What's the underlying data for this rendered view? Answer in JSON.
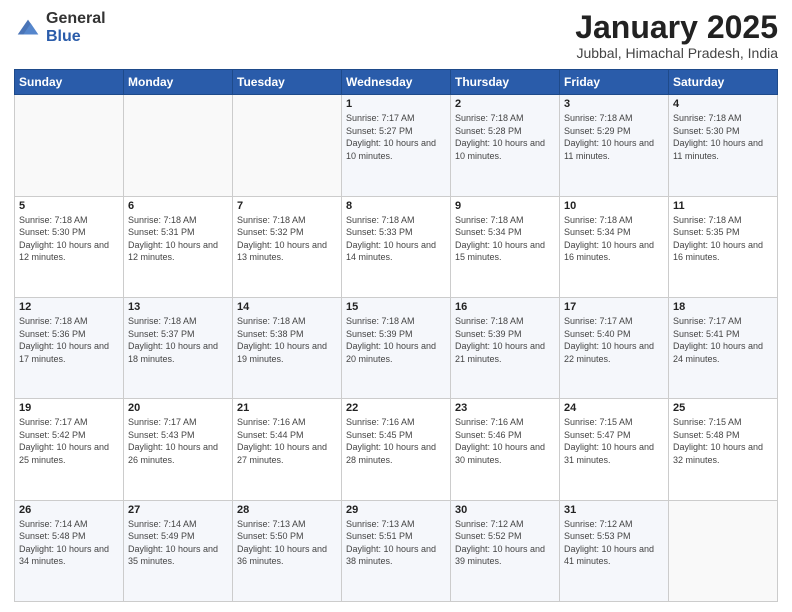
{
  "header": {
    "logo_general": "General",
    "logo_blue": "Blue",
    "month_title": "January 2025",
    "location": "Jubbal, Himachal Pradesh, India"
  },
  "days_of_week": [
    "Sunday",
    "Monday",
    "Tuesday",
    "Wednesday",
    "Thursday",
    "Friday",
    "Saturday"
  ],
  "weeks": [
    [
      {
        "day": "",
        "sunrise": "",
        "sunset": "",
        "daylight": ""
      },
      {
        "day": "",
        "sunrise": "",
        "sunset": "",
        "daylight": ""
      },
      {
        "day": "",
        "sunrise": "",
        "sunset": "",
        "daylight": ""
      },
      {
        "day": "1",
        "sunrise": "Sunrise: 7:17 AM",
        "sunset": "Sunset: 5:27 PM",
        "daylight": "Daylight: 10 hours and 10 minutes."
      },
      {
        "day": "2",
        "sunrise": "Sunrise: 7:18 AM",
        "sunset": "Sunset: 5:28 PM",
        "daylight": "Daylight: 10 hours and 10 minutes."
      },
      {
        "day": "3",
        "sunrise": "Sunrise: 7:18 AM",
        "sunset": "Sunset: 5:29 PM",
        "daylight": "Daylight: 10 hours and 11 minutes."
      },
      {
        "day": "4",
        "sunrise": "Sunrise: 7:18 AM",
        "sunset": "Sunset: 5:30 PM",
        "daylight": "Daylight: 10 hours and 11 minutes."
      }
    ],
    [
      {
        "day": "5",
        "sunrise": "Sunrise: 7:18 AM",
        "sunset": "Sunset: 5:30 PM",
        "daylight": "Daylight: 10 hours and 12 minutes."
      },
      {
        "day": "6",
        "sunrise": "Sunrise: 7:18 AM",
        "sunset": "Sunset: 5:31 PM",
        "daylight": "Daylight: 10 hours and 12 minutes."
      },
      {
        "day": "7",
        "sunrise": "Sunrise: 7:18 AM",
        "sunset": "Sunset: 5:32 PM",
        "daylight": "Daylight: 10 hours and 13 minutes."
      },
      {
        "day": "8",
        "sunrise": "Sunrise: 7:18 AM",
        "sunset": "Sunset: 5:33 PM",
        "daylight": "Daylight: 10 hours and 14 minutes."
      },
      {
        "day": "9",
        "sunrise": "Sunrise: 7:18 AM",
        "sunset": "Sunset: 5:34 PM",
        "daylight": "Daylight: 10 hours and 15 minutes."
      },
      {
        "day": "10",
        "sunrise": "Sunrise: 7:18 AM",
        "sunset": "Sunset: 5:34 PM",
        "daylight": "Daylight: 10 hours and 16 minutes."
      },
      {
        "day": "11",
        "sunrise": "Sunrise: 7:18 AM",
        "sunset": "Sunset: 5:35 PM",
        "daylight": "Daylight: 10 hours and 16 minutes."
      }
    ],
    [
      {
        "day": "12",
        "sunrise": "Sunrise: 7:18 AM",
        "sunset": "Sunset: 5:36 PM",
        "daylight": "Daylight: 10 hours and 17 minutes."
      },
      {
        "day": "13",
        "sunrise": "Sunrise: 7:18 AM",
        "sunset": "Sunset: 5:37 PM",
        "daylight": "Daylight: 10 hours and 18 minutes."
      },
      {
        "day": "14",
        "sunrise": "Sunrise: 7:18 AM",
        "sunset": "Sunset: 5:38 PM",
        "daylight": "Daylight: 10 hours and 19 minutes."
      },
      {
        "day": "15",
        "sunrise": "Sunrise: 7:18 AM",
        "sunset": "Sunset: 5:39 PM",
        "daylight": "Daylight: 10 hours and 20 minutes."
      },
      {
        "day": "16",
        "sunrise": "Sunrise: 7:18 AM",
        "sunset": "Sunset: 5:39 PM",
        "daylight": "Daylight: 10 hours and 21 minutes."
      },
      {
        "day": "17",
        "sunrise": "Sunrise: 7:17 AM",
        "sunset": "Sunset: 5:40 PM",
        "daylight": "Daylight: 10 hours and 22 minutes."
      },
      {
        "day": "18",
        "sunrise": "Sunrise: 7:17 AM",
        "sunset": "Sunset: 5:41 PM",
        "daylight": "Daylight: 10 hours and 24 minutes."
      }
    ],
    [
      {
        "day": "19",
        "sunrise": "Sunrise: 7:17 AM",
        "sunset": "Sunset: 5:42 PM",
        "daylight": "Daylight: 10 hours and 25 minutes."
      },
      {
        "day": "20",
        "sunrise": "Sunrise: 7:17 AM",
        "sunset": "Sunset: 5:43 PM",
        "daylight": "Daylight: 10 hours and 26 minutes."
      },
      {
        "day": "21",
        "sunrise": "Sunrise: 7:16 AM",
        "sunset": "Sunset: 5:44 PM",
        "daylight": "Daylight: 10 hours and 27 minutes."
      },
      {
        "day": "22",
        "sunrise": "Sunrise: 7:16 AM",
        "sunset": "Sunset: 5:45 PM",
        "daylight": "Daylight: 10 hours and 28 minutes."
      },
      {
        "day": "23",
        "sunrise": "Sunrise: 7:16 AM",
        "sunset": "Sunset: 5:46 PM",
        "daylight": "Daylight: 10 hours and 30 minutes."
      },
      {
        "day": "24",
        "sunrise": "Sunrise: 7:15 AM",
        "sunset": "Sunset: 5:47 PM",
        "daylight": "Daylight: 10 hours and 31 minutes."
      },
      {
        "day": "25",
        "sunrise": "Sunrise: 7:15 AM",
        "sunset": "Sunset: 5:48 PM",
        "daylight": "Daylight: 10 hours and 32 minutes."
      }
    ],
    [
      {
        "day": "26",
        "sunrise": "Sunrise: 7:14 AM",
        "sunset": "Sunset: 5:48 PM",
        "daylight": "Daylight: 10 hours and 34 minutes."
      },
      {
        "day": "27",
        "sunrise": "Sunrise: 7:14 AM",
        "sunset": "Sunset: 5:49 PM",
        "daylight": "Daylight: 10 hours and 35 minutes."
      },
      {
        "day": "28",
        "sunrise": "Sunrise: 7:13 AM",
        "sunset": "Sunset: 5:50 PM",
        "daylight": "Daylight: 10 hours and 36 minutes."
      },
      {
        "day": "29",
        "sunrise": "Sunrise: 7:13 AM",
        "sunset": "Sunset: 5:51 PM",
        "daylight": "Daylight: 10 hours and 38 minutes."
      },
      {
        "day": "30",
        "sunrise": "Sunrise: 7:12 AM",
        "sunset": "Sunset: 5:52 PM",
        "daylight": "Daylight: 10 hours and 39 minutes."
      },
      {
        "day": "31",
        "sunrise": "Sunrise: 7:12 AM",
        "sunset": "Sunset: 5:53 PM",
        "daylight": "Daylight: 10 hours and 41 minutes."
      },
      {
        "day": "",
        "sunrise": "",
        "sunset": "",
        "daylight": ""
      }
    ]
  ]
}
